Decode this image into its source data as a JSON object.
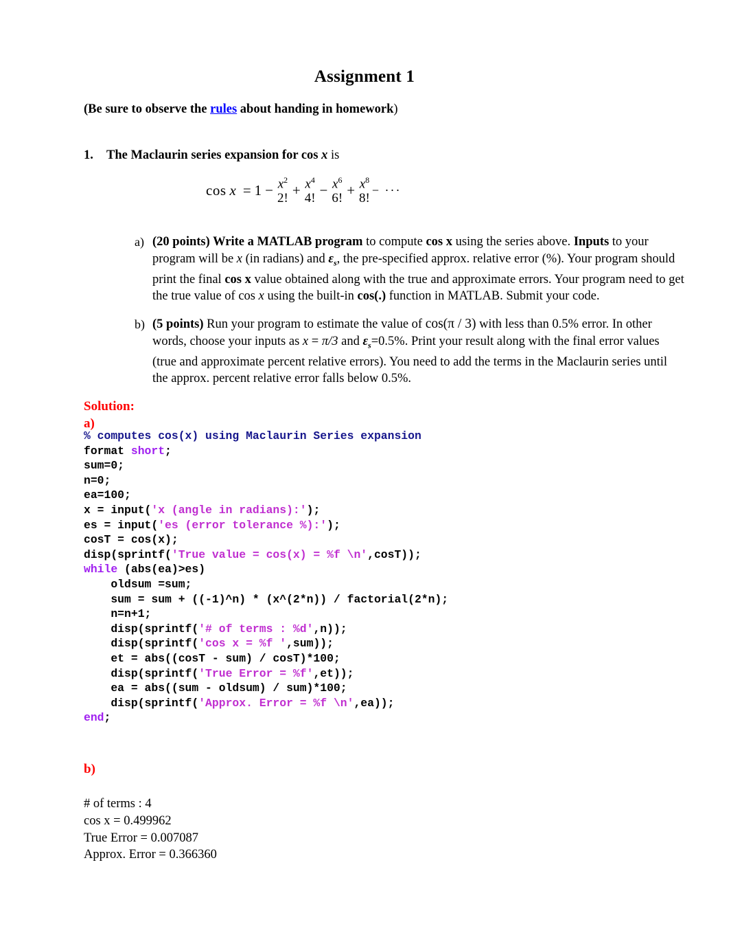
{
  "document": {
    "title": "Assignment 1",
    "subnote": {
      "prefix": "(Be sure to observe the ",
      "link": "rules",
      "suffix": " about handing in homework",
      "tail": ")"
    }
  },
  "problem": {
    "number": "1.",
    "stem_bold": "The Maclaurin series expansion for cos ",
    "stem_var": "x",
    "stem_tail": " is",
    "equation": {
      "lhs": "cos",
      "variable": "x",
      "equals": "=",
      "first_term": "1",
      "terms": [
        {
          "sign": "−",
          "numerator": "x",
          "power": "2",
          "denominator": "2!"
        },
        {
          "sign": "+",
          "numerator": "x",
          "power": "4",
          "denominator": "4!"
        },
        {
          "sign": "−",
          "numerator": "x",
          "power": "6",
          "denominator": "6!"
        },
        {
          "sign": "+",
          "numerator": "x",
          "power": "8",
          "denominator": "8!"
        }
      ],
      "trailing": "− ···",
      "plain_text": "cos x = 1 - x^2/2! + x^4/4! - x^6/6! + x^8/8! - ..."
    },
    "parts": [
      {
        "marker": "a)",
        "points": "(20 points)",
        "lead_bold": "Write a MATLAB program",
        "text_1": " to compute ",
        "cosx_bold": "cos x",
        "text_2": " using the series above. ",
        "inputs_bold": "Inputs",
        "text_3": " to your program will be ",
        "var_x": "x",
        "text_4": " (in radians) and ",
        "eps_symbol": "ε",
        "eps_sub": "s",
        "text_5": ", the pre-specified approx. relative error (%). Your program should print the final ",
        "cosx_bold_2": "cos x",
        "text_6": " value obtained along with the true and approximate errors. Your program need to get the true value of cos ",
        "var_x_2": "x",
        "text_7": " using the built-in ",
        "cosdot_bold": "cos(.)",
        "text_8": " function in MATLAB. Submit your code."
      },
      {
        "marker": "b)",
        "points": "(5 points)",
        "text_1": " Run your program to estimate the value of ",
        "math_cos": "cos(π / 3)",
        "text_2": "  with less than 0.5% error. In other words, choose your inputs as ",
        "var_x": "x",
        "text_3": " = ",
        "pi_over_3": "π/3",
        "text_4": " and ",
        "eps_symbol": "ε",
        "eps_sub": "s",
        "text_5": "=0.5%.  Print your result along with the final error values (true and approximate percent relative errors). You need to add the terms in the Maclaurin series until the approx. percent relative error falls below 0.5%."
      }
    ]
  },
  "solution": {
    "heading": "Solution:",
    "part_a_label": "a)",
    "part_b_label": "b)",
    "code_lines": [
      [
        {
          "t": "% computes cos(x) using Maclaurin Series expansion",
          "c": "comment"
        }
      ],
      [
        {
          "t": "format ",
          "c": "plain"
        },
        {
          "t": "short",
          "c": "kw"
        },
        {
          "t": ";",
          "c": "plain"
        }
      ],
      [
        {
          "t": "sum=0;",
          "c": "plain"
        }
      ],
      [
        {
          "t": "n=0;",
          "c": "plain"
        }
      ],
      [
        {
          "t": "ea=100;",
          "c": "plain"
        }
      ],
      [
        {
          "t": "x = input(",
          "c": "plain"
        },
        {
          "t": "'x (angle in radians):'",
          "c": "str"
        },
        {
          "t": ");",
          "c": "plain"
        }
      ],
      [
        {
          "t": "es = input(",
          "c": "plain"
        },
        {
          "t": "'es (error tolerance %):'",
          "c": "str"
        },
        {
          "t": ");",
          "c": "plain"
        }
      ],
      [
        {
          "t": "cosT = cos(x);",
          "c": "plain"
        }
      ],
      [
        {
          "t": "disp(sprintf(",
          "c": "plain"
        },
        {
          "t": "'True value = cos(x) = %f \\n'",
          "c": "str"
        },
        {
          "t": ",cosT));",
          "c": "plain"
        }
      ],
      [
        {
          "t": "while",
          "c": "kw"
        },
        {
          "t": " (abs(ea)>es)",
          "c": "plain"
        }
      ],
      [
        {
          "t": "    oldsum =sum;",
          "c": "plain"
        }
      ],
      [
        {
          "t": "    sum = sum + ((-1)^n) * (x^(2*n)) / factorial(2*n);",
          "c": "plain"
        }
      ],
      [
        {
          "t": "    n=n+1;",
          "c": "plain"
        }
      ],
      [
        {
          "t": "    disp(sprintf(",
          "c": "plain"
        },
        {
          "t": "'# of terms : %d'",
          "c": "str"
        },
        {
          "t": ",n));",
          "c": "plain"
        }
      ],
      [
        {
          "t": "    disp(sprintf(",
          "c": "plain"
        },
        {
          "t": "'cos x = %f '",
          "c": "str"
        },
        {
          "t": ",sum));",
          "c": "plain"
        }
      ],
      [
        {
          "t": "    et = abs((cosT - sum) / cosT)*100;",
          "c": "plain"
        }
      ],
      [
        {
          "t": "    disp(sprintf(",
          "c": "plain"
        },
        {
          "t": "'True Error = %f'",
          "c": "str"
        },
        {
          "t": ",et));",
          "c": "plain"
        }
      ],
      [
        {
          "t": "    ea = abs((sum - oldsum) / sum)*100;",
          "c": "plain"
        }
      ],
      [
        {
          "t": "    disp(sprintf(",
          "c": "plain"
        },
        {
          "t": "'Approx. Error = %f \\n'",
          "c": "str"
        },
        {
          "t": ",ea));",
          "c": "plain"
        }
      ],
      [
        {
          "t": "end",
          "c": "kw"
        },
        {
          "t": ";",
          "c": "plain"
        }
      ]
    ],
    "results": [
      "# of terms : 4",
      "cos x = 0.499962",
      "True Error = 0.007087",
      "Approx. Error = 0.366360"
    ]
  },
  "colors": {
    "solution_red": "#ff0000",
    "link_blue": "#0000ff",
    "code_comment_navy": "#16168c",
    "code_keyword_violet": "#a020f0",
    "code_string_magenta": "#c02fd0",
    "text_black": "#000000",
    "page_background": "#ffffff"
  }
}
